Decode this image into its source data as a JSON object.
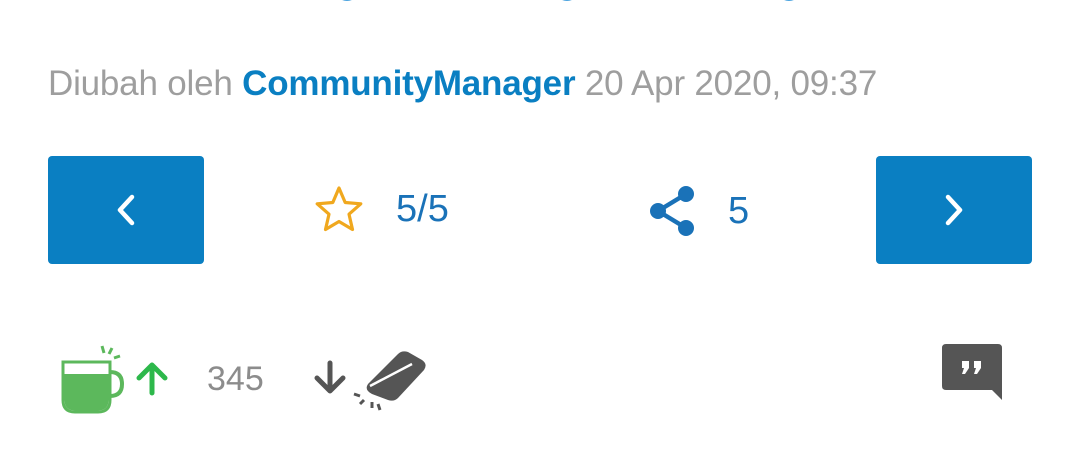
{
  "post": {
    "edited_prefix": "Diubah oleh",
    "author": "CommunityManager",
    "timestamp": "20 Apr 2020, 09:37"
  },
  "navigation": {
    "prev_icon": "chevron-left-icon",
    "next_icon": "chevron-right-icon"
  },
  "rating": {
    "icon": "star-outline-icon",
    "value": "5/5"
  },
  "share": {
    "icon": "share-icon",
    "count": "5"
  },
  "votes": {
    "up_icon": "mug-icon",
    "count": "345",
    "down_icon": "eraser-icon"
  },
  "actions": {
    "quote_icon": "quote-icon"
  },
  "colors": {
    "primary": "#0a7fc2",
    "meta_text": "#9e9e9e",
    "star": "#f0a81e",
    "vote_up": "#2db84b",
    "mug": "#5cb85c",
    "icon_dark": "#555555"
  }
}
